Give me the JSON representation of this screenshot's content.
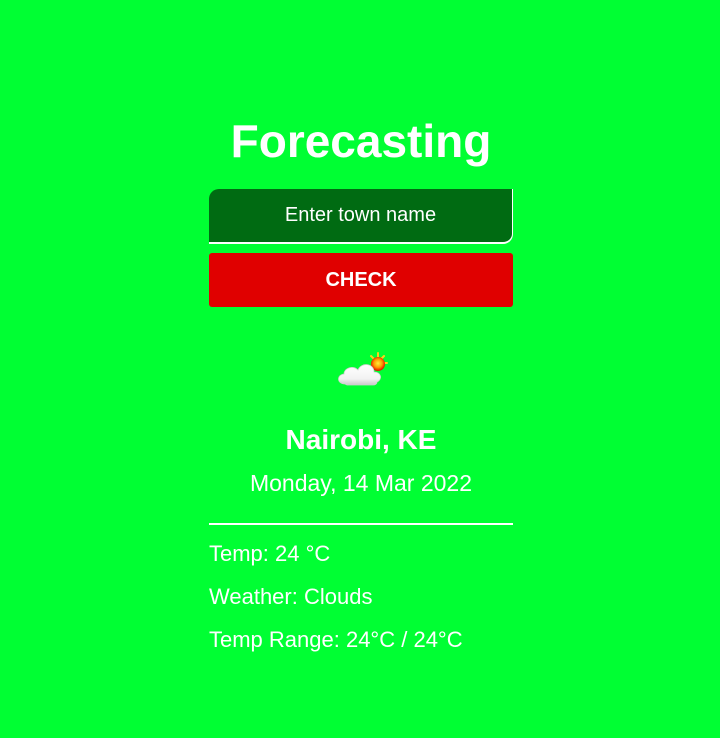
{
  "app": {
    "title": "Forecasting"
  },
  "search": {
    "placeholder": "Enter town name",
    "value": "",
    "button_label": "CHECK"
  },
  "result": {
    "icon": "partly-cloudy-icon",
    "location": "Nairobi, KE",
    "date": "Monday, 14 Mar 2022",
    "temp": "Temp: 24 °C",
    "weather": "Weather: Clouds",
    "temp_range": "Temp Range: 24°C / 24°C"
  },
  "colors": {
    "background": "#00ff33",
    "input_background": "#006b12",
    "button_background": "#e00000",
    "text": "#ffffff"
  }
}
